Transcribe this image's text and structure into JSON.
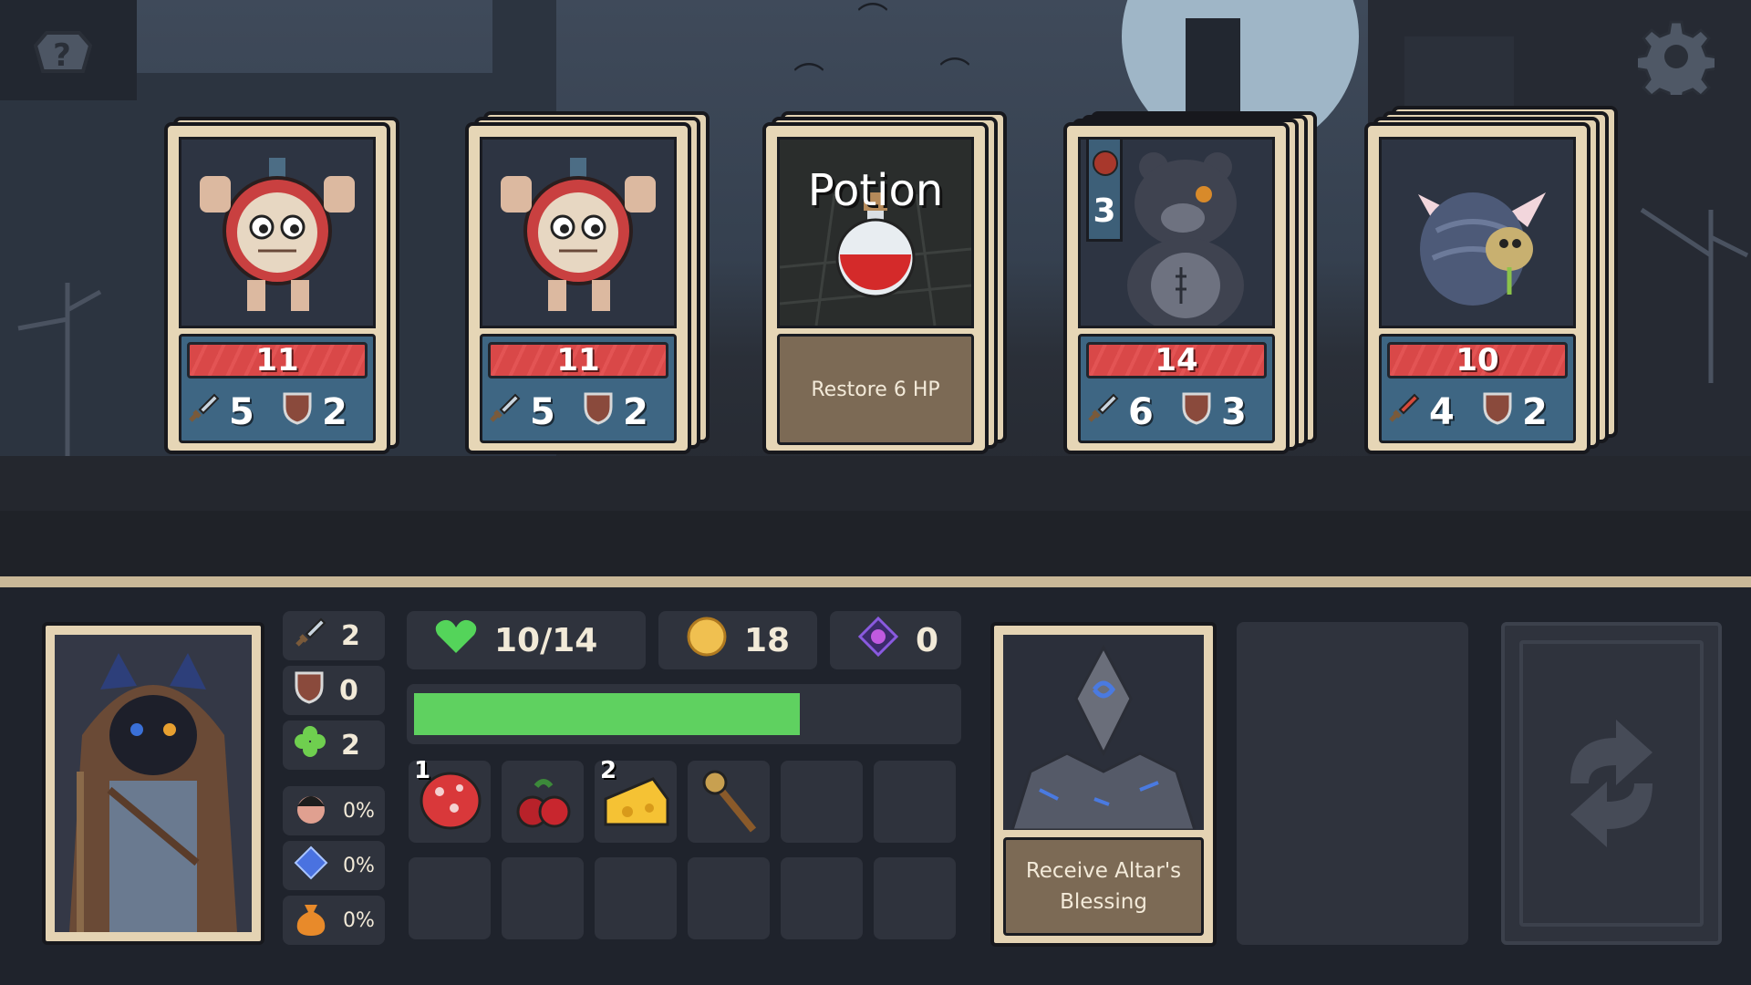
{
  "colors": {
    "hp_red": "#d94848",
    "hp_green": "#5fd160",
    "card_cream": "#e6d6b6",
    "card_blue": "#3e6683",
    "card_brown": "#7c6a55",
    "panel_bg": "#1f232c"
  },
  "top_bar": {
    "help_icon": "help-question-icon",
    "settings_icon": "gear-icon"
  },
  "cards": [
    {
      "type": "enemy",
      "creature": "wind-up-clock-toy",
      "hp": "11",
      "attack": "5",
      "defense": "2"
    },
    {
      "type": "enemy",
      "creature": "wind-up-clock-toy",
      "hp": "11",
      "attack": "5",
      "defense": "2"
    },
    {
      "type": "item",
      "title": "Potion",
      "description": "Restore 6 HP"
    },
    {
      "type": "enemy",
      "creature": "stitched-teddy-bear",
      "level": "3",
      "hp": "14",
      "attack": "6",
      "defense": "3"
    },
    {
      "type": "enemy",
      "creature": "hermit-crab-fly",
      "hp": "10",
      "attack": "4",
      "defense": "2",
      "attack_icon": "poison-sword-icon"
    }
  ],
  "player": {
    "attack": "2",
    "defense": "0",
    "luck": "2",
    "crit_chance": "0%",
    "gem_chance": "0%",
    "gold_bonus": "0%",
    "hp_text": "10/14",
    "hp_current": 10,
    "hp_max": 14,
    "gold": "18",
    "soul_gems": "0"
  },
  "inventory": [
    {
      "item": "mushroom",
      "count": "1"
    },
    {
      "item": "cherries",
      "count": ""
    },
    {
      "item": "cheese",
      "count": "2"
    },
    {
      "item": "wooden-staff",
      "count": ""
    }
  ],
  "event_card": {
    "description": "Receive Altar's Blessing"
  }
}
